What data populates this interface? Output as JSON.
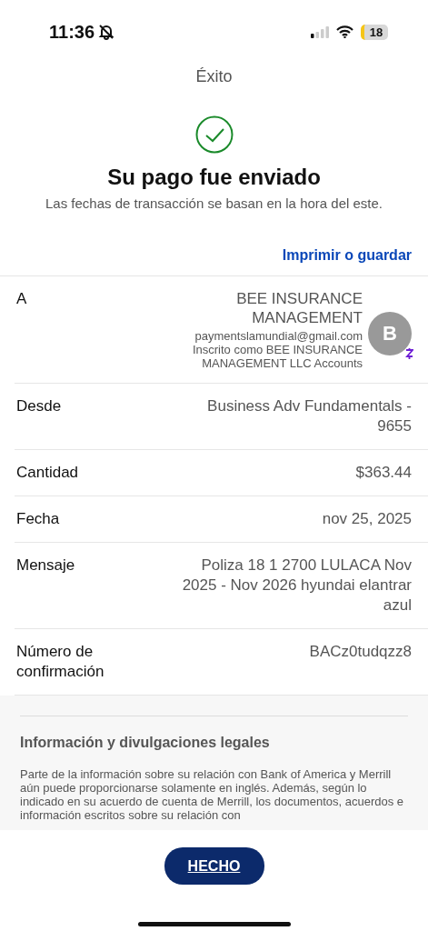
{
  "status_bar": {
    "time": "11:36",
    "battery": "18"
  },
  "header": {
    "title": "Éxito"
  },
  "confirmation": {
    "heading": "Su pago fue enviado",
    "subtitle": "Las fechas de transacción se basan en la hora del este."
  },
  "print_link": "Imprimir o guardar",
  "details": [
    {
      "kind": "recipient",
      "label": "A",
      "name": "BEE INSURANCE MANAGEMENT",
      "email": "paymentslamundial@gmail.com",
      "note": "Inscrito como BEE INSURANCE MANAGEMENT LLC Accounts",
      "avatar": "B"
    },
    {
      "kind": "text",
      "label": "Desde",
      "value": "Business Adv Fundamentals - 9655"
    },
    {
      "kind": "text",
      "label": "Cantidad",
      "value": "$363.44"
    },
    {
      "kind": "text",
      "label": "Fecha",
      "value": "nov 25, 2025"
    },
    {
      "kind": "text",
      "label": "Mensaje",
      "value": "Poliza 18 1 2700 LULACA  Nov 2025 - Nov 2026 hyundai elantrar azul"
    },
    {
      "kind": "text",
      "label": "Número de confirmación",
      "value": "BACz0tudqzz8"
    }
  ],
  "legal": {
    "title": "Información y divulgaciones legales",
    "text": "Parte de la información sobre su relación con Bank of America y Merrill aún puede proporcionarse solamente en inglés. Además, según lo indicado en su acuerdo de cuenta de Merrill, los documentos, acuerdos e información escritos sobre su relación con"
  },
  "done_button": "HECHO"
}
